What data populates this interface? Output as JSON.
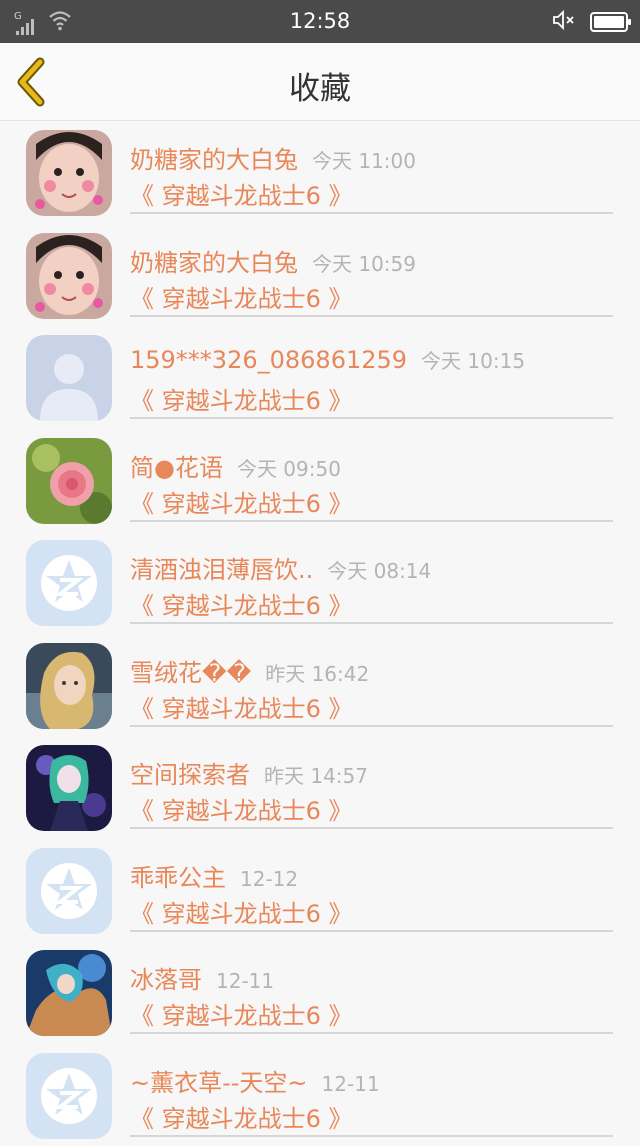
{
  "status_bar": {
    "network_label": "G",
    "time": "12:58",
    "icons": [
      "signal-icon",
      "wifi-icon",
      "mute-icon",
      "battery-icon"
    ]
  },
  "header": {
    "title": "收藏",
    "back_icon": "chevron-left-icon"
  },
  "colors": {
    "accent": "#e8885a",
    "back_arrow": "#e8b820",
    "timestamp": "#b4b4b4"
  },
  "items": [
    {
      "name": "奶糖家的大白兔",
      "time": "今天 11:00",
      "title": "《 穿越斗龙战士6 》",
      "avatar": "child-photo"
    },
    {
      "name": "奶糖家的大白兔",
      "time": "今天 10:59",
      "title": "《 穿越斗龙战士6 》",
      "avatar": "child-photo"
    },
    {
      "name": "159***326_086861259",
      "time": "今天 10:15",
      "title": "《 穿越斗龙战士6 》",
      "avatar": "default-person"
    },
    {
      "name": "简●花语",
      "time": "今天 09:50",
      "title": "《 穿越斗龙战士6 》",
      "avatar": "flower-photo"
    },
    {
      "name": "清酒浊泪薄唇饮..",
      "time": "今天 08:14",
      "title": "《 穿越斗龙战士6 》",
      "avatar": "default-qq"
    },
    {
      "name": "雪绒花��",
      "time": "昨天 16:42",
      "title": "《 穿越斗龙战士6 》",
      "avatar": "girl-photo"
    },
    {
      "name": "空间探索者",
      "time": "昨天 14:57",
      "title": "《 穿越斗龙战士6 》",
      "avatar": "anime-photo"
    },
    {
      "name": "乖乖公主",
      "time": "12-12",
      "title": "《 穿越斗龙战士6 》",
      "avatar": "default-qq"
    },
    {
      "name": "冰落哥",
      "time": "12-11",
      "title": "《 穿越斗龙战士6 》",
      "avatar": "anime-blue-photo"
    },
    {
      "name": "~薰衣草--天空~",
      "time": "12-11",
      "title": "《 穿越斗龙战士6 》",
      "avatar": "default-qq"
    }
  ]
}
